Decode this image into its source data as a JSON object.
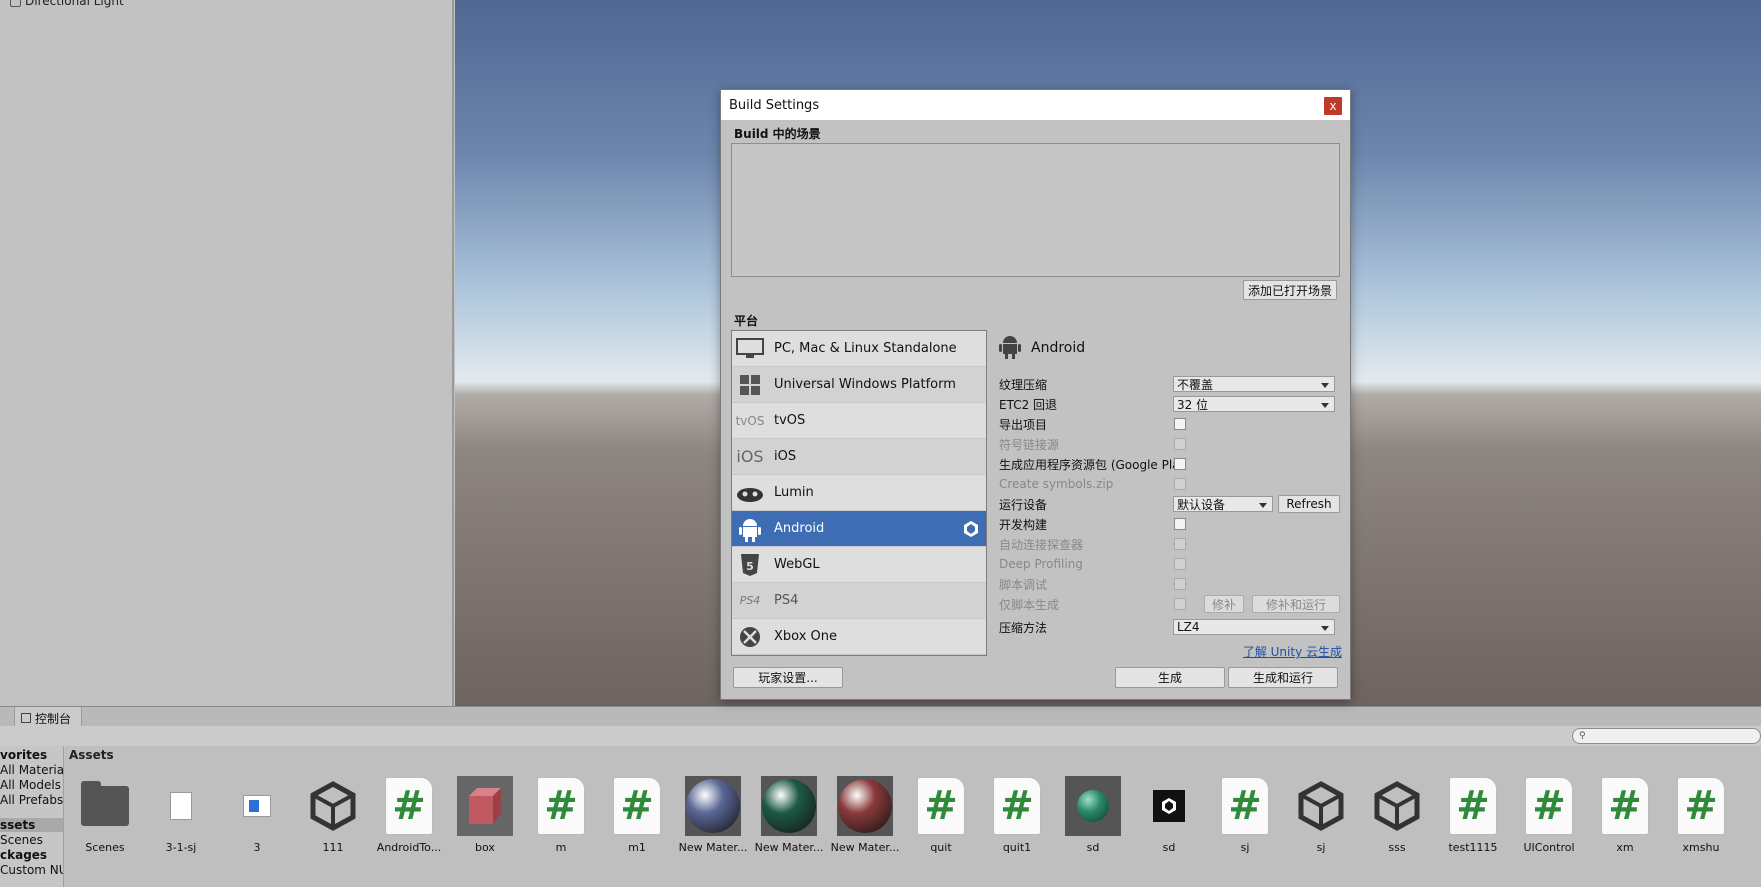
{
  "hierarchy": {
    "items": [
      {
        "label": "Directional Light"
      }
    ]
  },
  "console": {
    "tab_label": "控制台"
  },
  "project": {
    "search_placeholder": "",
    "left_items": [
      "vorites",
      "All Material",
      "All Models",
      "All Prefabs",
      "ssets",
      "Scenes",
      "ckages",
      "Custom NU"
    ],
    "assets_header": "Assets",
    "assets": [
      {
        "label": "Scenes",
        "kind": "folder"
      },
      {
        "label": "3-1-sj",
        "kind": "doc"
      },
      {
        "label": "3",
        "kind": "blue-doc"
      },
      {
        "label": "111",
        "kind": "unity"
      },
      {
        "label": "AndroidTo...",
        "kind": "cs"
      },
      {
        "label": "box",
        "kind": "box",
        "color": "#c05a60"
      },
      {
        "label": "m",
        "kind": "cs"
      },
      {
        "label": "m1",
        "kind": "cs"
      },
      {
        "label": "New Mater...",
        "kind": "sphere",
        "color": "#5a6795"
      },
      {
        "label": "New Mater...",
        "kind": "sphere",
        "color": "#1e5a44"
      },
      {
        "label": "New Mater...",
        "kind": "sphere",
        "color": "#8a3a3a"
      },
      {
        "label": "quit",
        "kind": "cs"
      },
      {
        "label": "quit1",
        "kind": "cs"
      },
      {
        "label": "sd",
        "kind": "sphere-small",
        "color": "#2a8a6a"
      },
      {
        "label": "sd",
        "kind": "unity-black"
      },
      {
        "label": "sj",
        "kind": "cs"
      },
      {
        "label": "sj",
        "kind": "unity"
      },
      {
        "label": "sss",
        "kind": "unity"
      },
      {
        "label": "test1115",
        "kind": "cs"
      },
      {
        "label": "UIControl",
        "kind": "cs"
      },
      {
        "label": "xm",
        "kind": "cs"
      },
      {
        "label": "xmshu",
        "kind": "cs"
      }
    ]
  },
  "dialog": {
    "title": "Build Settings",
    "close_label": "x",
    "scenes_label": "Build 中的场景",
    "add_open_scenes": "添加已打开场景",
    "platform_label": "平台",
    "platforms": [
      {
        "label": "PC, Mac & Linux Standalone",
        "icon": "monitor-icon"
      },
      {
        "label": "Universal Windows Platform",
        "icon": "windows-icon"
      },
      {
        "label": "tvOS",
        "icon": "tvos-icon",
        "icon_text": "tvOS"
      },
      {
        "label": "iOS",
        "icon": "ios-icon",
        "icon_text": "iOS"
      },
      {
        "label": "Lumin",
        "icon": "lumin-icon"
      },
      {
        "label": "Android",
        "icon": "android-icon",
        "selected": true
      },
      {
        "label": "WebGL",
        "icon": "html5-icon"
      },
      {
        "label": "PS4",
        "icon": "ps4-icon",
        "icon_text": "PS4"
      },
      {
        "label": "Xbox One",
        "icon": "xbox-icon"
      }
    ],
    "selected_platform": "Android",
    "settings": {
      "texture_compression": {
        "label": "纹理压缩",
        "value": "不覆盖"
      },
      "etc2_fallback": {
        "label": "ETC2 回退",
        "value": "32 位"
      },
      "export_project": {
        "label": "导出项目"
      },
      "symlink_sources": {
        "label": "符号链接源"
      },
      "build_app_bundle": {
        "label": "生成应用程序资源包 (Google Play)"
      },
      "create_symbols": {
        "label": "Create symbols.zip"
      },
      "run_device": {
        "label": "运行设备",
        "value": "默认设备",
        "refresh": "Refresh"
      },
      "dev_build": {
        "label": "开发构建"
      },
      "autoconnect_profiler": {
        "label": "自动连接探查器"
      },
      "deep_profiling": {
        "label": "Deep Profiling"
      },
      "script_debugging": {
        "label": "脚本调试"
      },
      "scripts_only": {
        "label": "仅脚本生成",
        "patch": "修补",
        "patch_run": "修补和运行"
      },
      "compression": {
        "label": "压缩方法",
        "value": "LZ4"
      }
    },
    "cloud_link": "了解 Unity 云生成",
    "player_settings": "玩家设置...",
    "build": "生成",
    "build_and_run": "生成和运行"
  }
}
